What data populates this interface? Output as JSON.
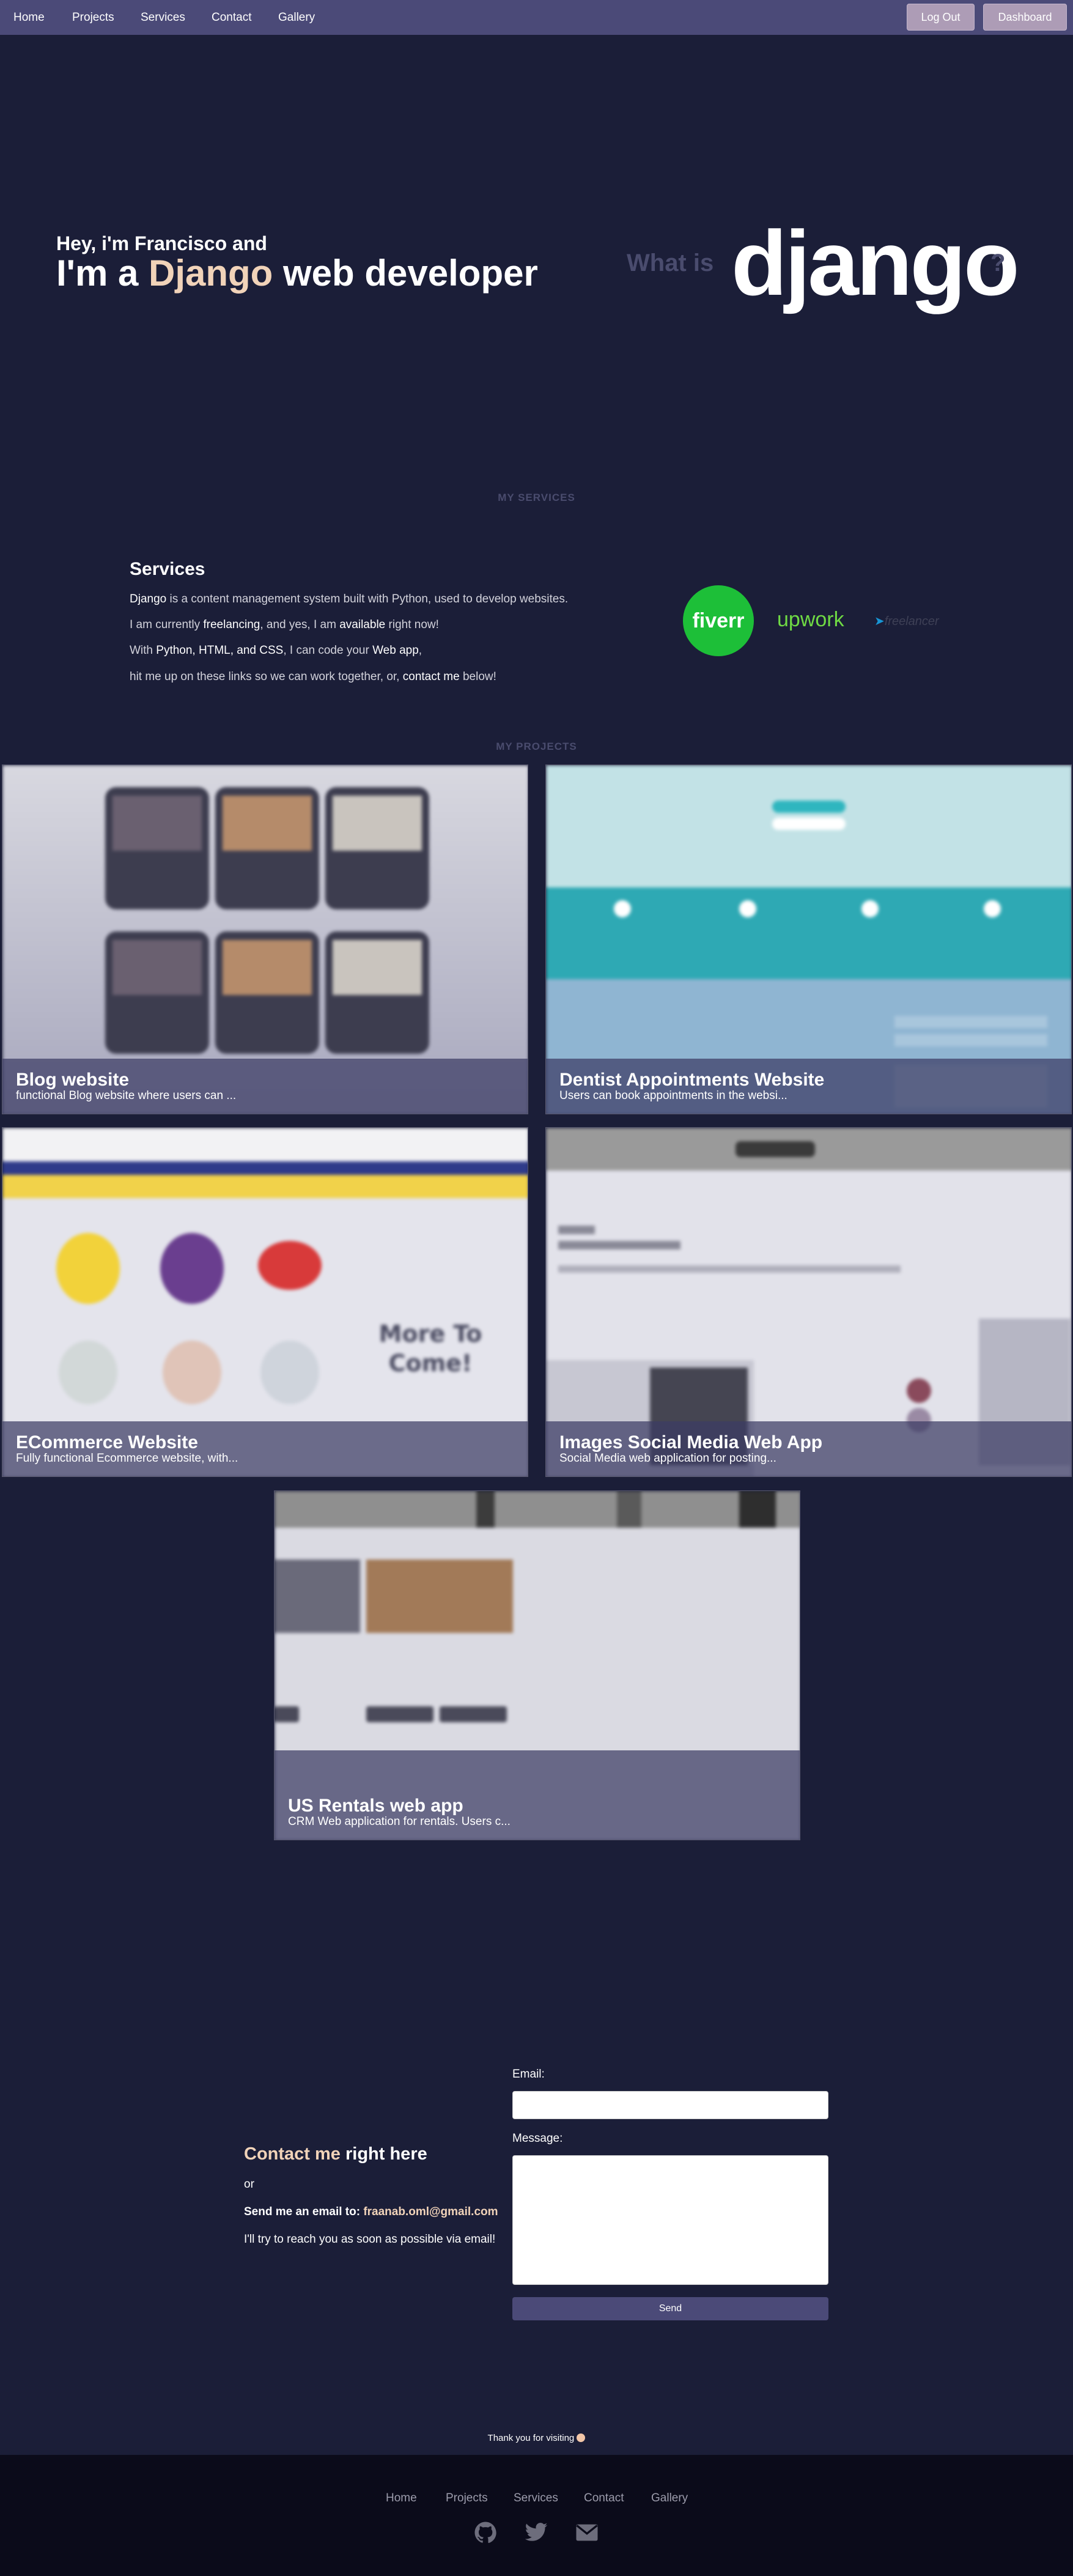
{
  "nav": {
    "links": [
      "Home",
      "Projects",
      "Services",
      "Contact",
      "Gallery"
    ],
    "logout_label": "Log Out",
    "dashboard_label": "Dashboard"
  },
  "hero": {
    "greeting": "Hey, i'm Francisco and",
    "title_prefix": "I'm a",
    "title_accent": "Django",
    "title_suffix": "web developer",
    "what_is": "What is",
    "logo_text": "django",
    "question_mark": "?"
  },
  "services": {
    "section_label": "MY SERVICES",
    "heading": "Services",
    "line1_bold": "Django",
    "line1_rest": "is a content management system built with Python, used to develop websites.",
    "line2_a": "I am currently",
    "line2_b": "freelancing",
    "line2_c": ", and yes, I am",
    "line2_d": "available",
    "line2_e": "right now!",
    "line3_a": "With",
    "line3_b": "Python, HTML, and CSS",
    "line3_c": ", I can code your",
    "line3_d": "Web app",
    "line3_e": ",",
    "line4_a": "hit me up on these links so we can work together, or,",
    "line4_b": "contact me",
    "line4_c": "below!",
    "platforms": [
      "fiverr",
      "upwork",
      "freelancer"
    ]
  },
  "projects": {
    "section_label": "MY PROJECTS",
    "items": [
      {
        "title": "Blog website",
        "desc": "functional Blog website where users can ..."
      },
      {
        "title": "Dentist Appointments Website",
        "desc": "Users can book appointments in the websi..."
      },
      {
        "title": "ECommerce Website",
        "desc": "Fully functional Ecommerce website, with..."
      },
      {
        "title": "Images Social Media Web App",
        "desc": "Social Media web application for posting..."
      },
      {
        "title": "US Rentals web app",
        "desc": "CRM Web application for rentals. Users c..."
      }
    ]
  },
  "contact": {
    "heading_accent": "Contact me",
    "heading_rest": "right here",
    "or": "or",
    "email_prefix": "Send me an email to:",
    "email": "fraanab.oml@gmail.com",
    "reply_note": "I'll try to reach you as soon as possible via email!",
    "email_label": "Email:",
    "message_label": "Message:",
    "send_label": "Send"
  },
  "footer": {
    "thanks": "Thank you for visiting",
    "links": [
      "Home",
      "Projects",
      "Services",
      "Contact",
      "Gallery"
    ],
    "icons": [
      "github-icon",
      "twitter-icon",
      "envelope-icon"
    ]
  },
  "colors": {
    "background": "#1b1e38",
    "navbar": "#4b4a78",
    "accent": "#f1d3b9",
    "button": "#ad9cb6",
    "footer": "#0b0b1a"
  }
}
